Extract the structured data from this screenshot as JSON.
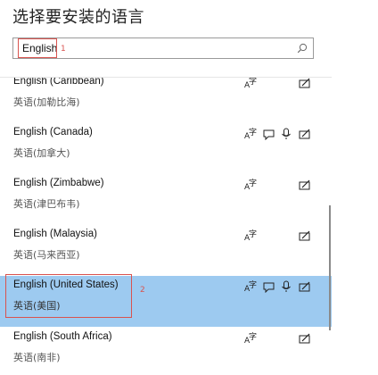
{
  "title": "选择要安装的语言",
  "search": {
    "value": "English"
  },
  "annotations": {
    "marker1": "1",
    "marker2": "2"
  },
  "languages": [
    {
      "name": "English (Caribbean)",
      "native": "英语(加勒比海)",
      "features": [
        "display"
      ],
      "selected": false
    },
    {
      "name": "English (Canada)",
      "native": "英语(加拿大)",
      "features": [
        "display",
        "speech-tts",
        "mic",
        "handwriting"
      ],
      "selected": false
    },
    {
      "name": "English (Zimbabwe)",
      "native": "英语(津巴布韦)",
      "features": [
        "display",
        "handwriting"
      ],
      "selected": false
    },
    {
      "name": "English (Malaysia)",
      "native": "英语(马来西亚)",
      "features": [
        "display",
        "handwriting"
      ],
      "selected": false
    },
    {
      "name": "English (United States)",
      "native": "英语(美国)",
      "features": [
        "display",
        "speech-tts",
        "mic",
        "handwriting"
      ],
      "selected": true
    },
    {
      "name": "English (South Africa)",
      "native": "英语(南非)",
      "features": [
        "display",
        "handwriting"
      ],
      "selected": false
    }
  ],
  "colors": {
    "selected_bg": "#9dcaf0",
    "annotation": "#d9534f"
  }
}
